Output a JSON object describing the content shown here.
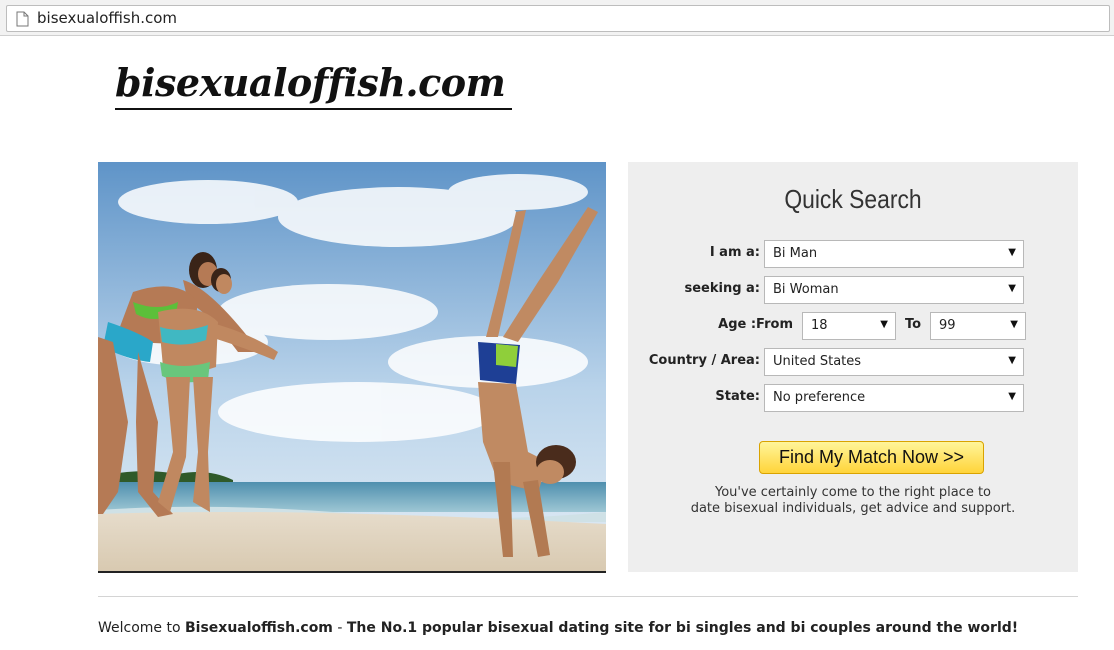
{
  "browser": {
    "url": "bisexualoffish.com"
  },
  "logo": {
    "text": "bisexualoffish.com"
  },
  "search": {
    "title": "Quick Search",
    "i_am_label": "I am a:",
    "i_am_value": "Bi Man",
    "seeking_label": "seeking a:",
    "seeking_value": "Bi Woman",
    "age_label": "Age :From",
    "age_from": "18",
    "age_to_label": "To",
    "age_to": "99",
    "country_label": "Country / Area:",
    "country_value": "United States",
    "state_label": "State:",
    "state_value": "No preference",
    "button_label": "Find My Match Now >>",
    "tagline_line1": "You've certainly come to the right place to",
    "tagline_line2": "date bisexual individuals, get advice and support."
  },
  "footer": {
    "welcome_prefix": "Welcome to ",
    "site_name": "Bisexualoffish.com",
    "welcome_separator": " - ",
    "welcome_tagline": "The No.1 popular bisexual dating site for bi singles and bi couples around the world!"
  },
  "icons": {
    "page": "page-icon",
    "caret": "caret-down-icon"
  },
  "colors": {
    "panel_bg": "#eeeeee",
    "button_top": "#fff59a",
    "button_bottom": "#ffd43a"
  }
}
